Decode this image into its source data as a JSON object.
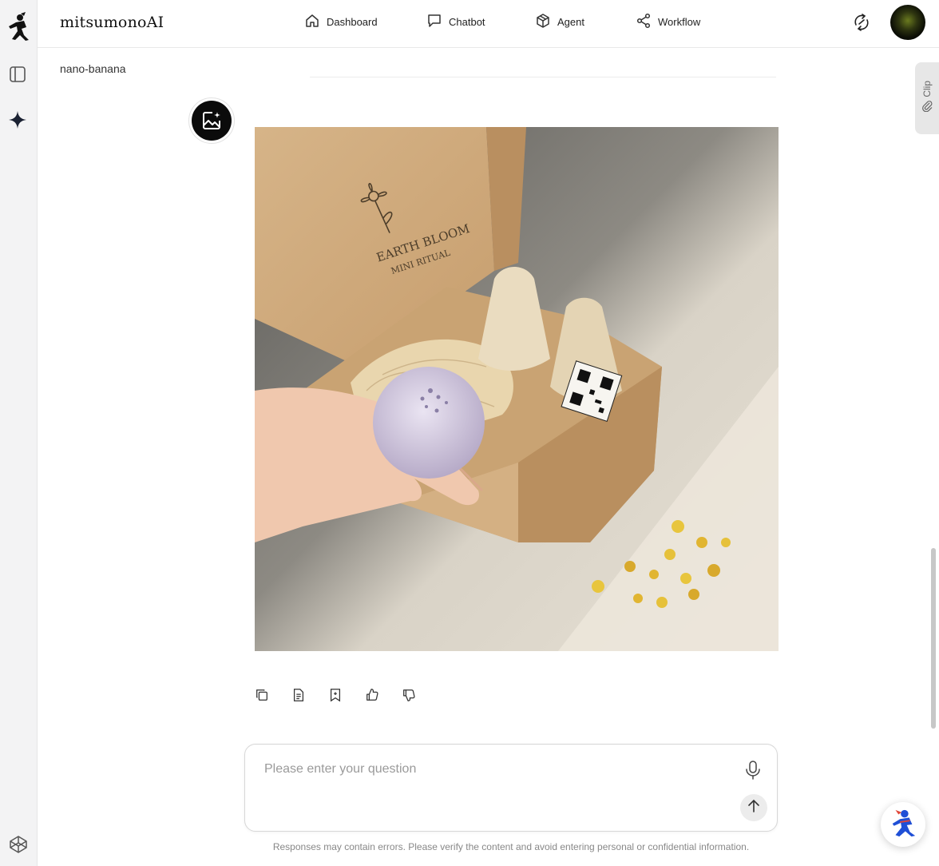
{
  "app": {
    "brand": "mitsumonoAI"
  },
  "nav": [
    {
      "label": "Dashboard",
      "icon": "home-icon"
    },
    {
      "label": "Chatbot",
      "icon": "chat-bubble-icon"
    },
    {
      "label": "Agent",
      "icon": "cube-icon"
    },
    {
      "label": "Workflow",
      "icon": "share-nodes-icon"
    }
  ],
  "conversation": {
    "model_label": "nano-banana",
    "image_alt": "Generated product photo",
    "image_text": {
      "box_line1": "EARTH BLOOM",
      "box_line2": "MINI RITUAL"
    },
    "actions": [
      "copy-icon",
      "document-icon",
      "bookmark-icon",
      "thumbs-up-icon",
      "thumbs-down-icon"
    ]
  },
  "composer": {
    "placeholder": "Please enter your question",
    "disclaimer": "Responses may contain errors. Please verify the content and avoid entering personal or confidential information."
  },
  "clip_tab": {
    "label": "Clip"
  },
  "colors": {
    "rail_bg": "#f3f3f4",
    "accent_blue": "#1f4fd6",
    "bot_avatar": "#0b0b0b"
  }
}
